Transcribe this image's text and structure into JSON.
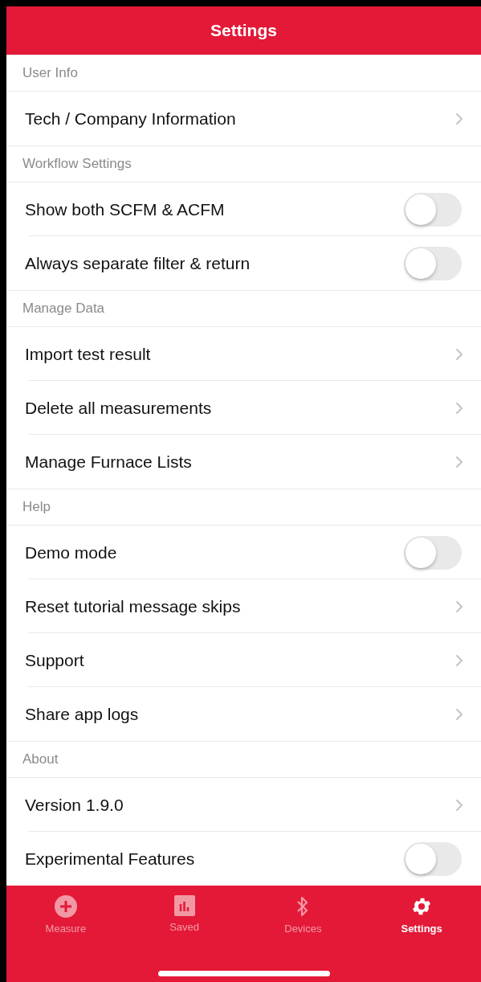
{
  "header": {
    "title": "Settings"
  },
  "sections": [
    {
      "title": "User Info",
      "rows": [
        {
          "label": "Tech / Company Information",
          "kind": "link"
        }
      ]
    },
    {
      "title": "Workflow Settings",
      "rows": [
        {
          "label": "Show both SCFM & ACFM",
          "kind": "toggle",
          "on": false
        },
        {
          "label": "Always separate filter & return",
          "kind": "toggle",
          "on": false
        }
      ]
    },
    {
      "title": "Manage Data",
      "rows": [
        {
          "label": "Import test result",
          "kind": "link"
        },
        {
          "label": "Delete all measurements",
          "kind": "link"
        },
        {
          "label": "Manage Furnace Lists",
          "kind": "link"
        }
      ]
    },
    {
      "title": "Help",
      "rows": [
        {
          "label": "Demo mode",
          "kind": "toggle",
          "on": false
        },
        {
          "label": "Reset tutorial message skips",
          "kind": "link"
        },
        {
          "label": "Support",
          "kind": "link"
        },
        {
          "label": "Share app logs",
          "kind": "link"
        }
      ]
    },
    {
      "title": "About",
      "rows": [
        {
          "label": "Version 1.9.0",
          "kind": "link"
        },
        {
          "label": "Experimental Features",
          "kind": "toggle",
          "on": false
        }
      ]
    }
  ],
  "tabs": [
    {
      "label": "Measure",
      "kind": "plus",
      "selected": false
    },
    {
      "label": "Saved",
      "kind": "chart",
      "selected": false
    },
    {
      "label": "Devices",
      "kind": "bluetooth",
      "selected": false
    },
    {
      "label": "Settings",
      "kind": "gear",
      "selected": true
    }
  ]
}
